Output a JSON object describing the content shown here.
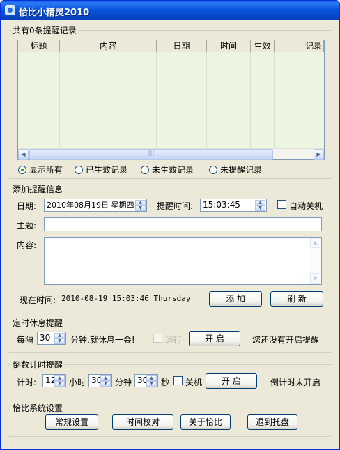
{
  "window": {
    "title": "恰比小精灵2010"
  },
  "records": {
    "legend": "共有0条提醒记录",
    "columns": [
      "标题",
      "内容",
      "日期",
      "时间",
      "生效",
      "记录"
    ],
    "scroll_thumb": "|||",
    "filters": [
      "显示所有",
      "已生效记录",
      "未生效记录",
      "未提醒记录"
    ],
    "selected_filter": "显示所有"
  },
  "add": {
    "legend": "添加提醒信息",
    "date_label": "日期:",
    "date_value": "2010年08月19日  星期四",
    "remind_time_label": "提醒时间:",
    "remind_time_value": "15:03:45",
    "auto_shutdown_label": "自动关机",
    "subject_label": "主题:",
    "subject_value": "",
    "content_label": "内容:",
    "now_label": "现在时间:",
    "now_value": "2010-08-19 15:03:46 Thursday",
    "add_button": "添  加",
    "refresh_button": "刷  新"
  },
  "rest": {
    "legend": "定时休息提醒",
    "every_label": "每隔",
    "minutes_value": "30",
    "suffix_label": "分钟,就休息一会!",
    "run_label": "运行",
    "start_button": "开  启",
    "status": "您还没有开启提醒"
  },
  "countdown": {
    "legend": "倒数计时提醒",
    "timer_label": "计时:",
    "hours_value": "12",
    "hours_label": "小时",
    "minutes_value": "30",
    "minutes_label": "分钟",
    "seconds_value": "30",
    "seconds_label": "秒",
    "shutdown_label": "关机",
    "start_button": "开  启",
    "status": "倒计时未开启"
  },
  "system": {
    "legend": "恰比系统设置",
    "buttons": [
      "常规设置",
      "时间校对",
      "关于恰比",
      "退到托盘"
    ]
  }
}
